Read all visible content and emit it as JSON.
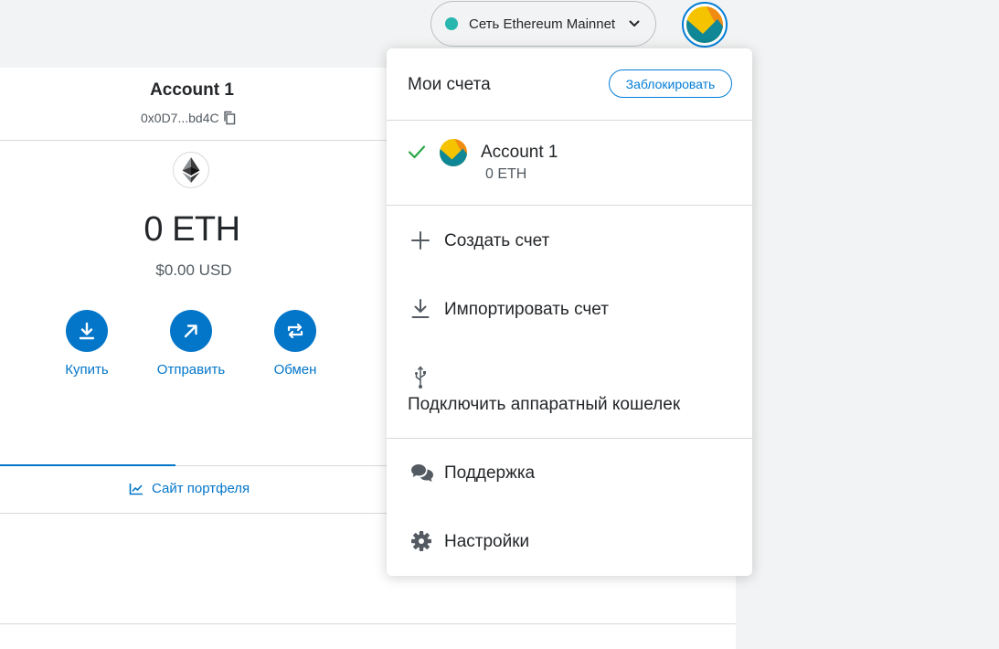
{
  "header": {
    "network_label": "Сеть Ethereum Mainnet",
    "network_dot_color": "#29b6af",
    "avatar_icon": "account-avatar-icon"
  },
  "wallet": {
    "account_name": "Account 1",
    "address": "0x0D7...bd4C",
    "balance": "0 ETH",
    "fiat_balance": "$0.00 USD",
    "actions": [
      {
        "label": "Купить",
        "icon": "download-icon"
      },
      {
        "label": "Отправить",
        "icon": "arrow-up-right-icon"
      },
      {
        "label": "Обмен",
        "icon": "swap-icon"
      }
    ],
    "portfolio_link": "Сайт портфеля",
    "accent_color": "#0376c9"
  },
  "menu": {
    "title": "Мои счета",
    "lock_label": "Заблокировать",
    "accounts": [
      {
        "name": "Account 1",
        "balance": "0 ETH",
        "selected": true
      }
    ],
    "items": [
      {
        "label": "Создать счет",
        "icon": "plus-icon"
      },
      {
        "label": "Импортировать счет",
        "icon": "import-icon"
      },
      {
        "label": "Подключить аппаратный кошелек",
        "icon": "usb-icon"
      },
      {
        "label": "Поддержка",
        "icon": "chat-icon"
      },
      {
        "label": "Настройки",
        "icon": "gear-icon"
      }
    ]
  }
}
